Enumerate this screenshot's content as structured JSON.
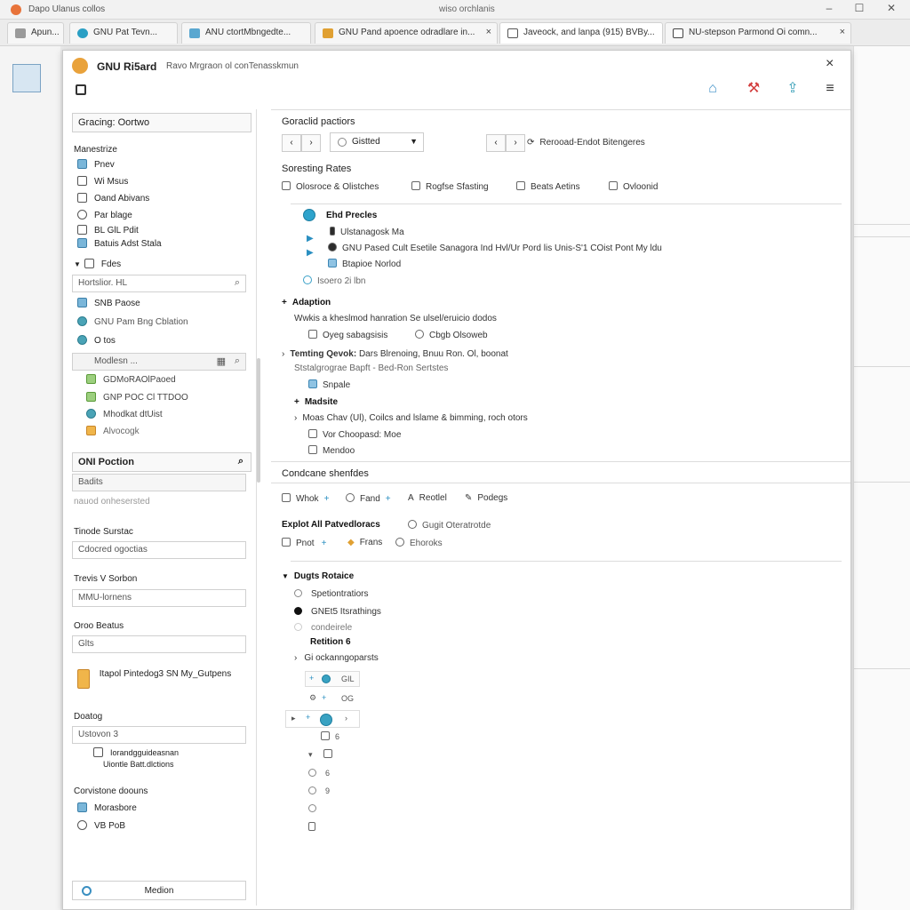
{
  "os": {
    "app": "Dapo Ulanus collos",
    "title": "wiso orchlanis",
    "minimize": "–",
    "maximize": "☐",
    "close": "✕"
  },
  "tabs": [
    {
      "label": "Apun...",
      "color": "#9a9a9a"
    },
    {
      "label": "GNU Pat Tevn...",
      "color": "#2a9fc4"
    },
    {
      "label": "ANU ctortMbngedte...",
      "color": "#5aa7d0"
    },
    {
      "label": "GNU Pand apoence odradlare in...",
      "color": "#e0a032",
      "close": "×"
    },
    {
      "label": "Javeock, and lanpa (915) BVBy...",
      "color": "#555555"
    },
    {
      "label": "NU-stepson Parmond Oi comn...",
      "color": "#444444",
      "close": "×"
    }
  ],
  "dialog": {
    "title": "GNU Ri5ard",
    "subtitle": "Ravo Mrgraon ol conTenasskmun",
    "close": "×",
    "header_icons": [
      "home-icon",
      "tools-icon",
      "share-icon",
      "menu-icon"
    ]
  },
  "sidebar": {
    "header": "Gracing: Oortwo",
    "section_manage": "Manestrize",
    "manage_items": [
      "Pnev",
      "Wi Msus",
      "Oand Abivans",
      "Par blage",
      "BL GlL Pdit",
      "Batuis Adst Stala"
    ],
    "files_label": "Fdes",
    "search_placeholder": "Hortslior. HL",
    "file_items": [
      "SNB Paose",
      "GNU Pam Bng Cblation",
      "O tos"
    ],
    "selected_item": "Modlesn ...",
    "sub_items": [
      "GDMoRAOlPaoed",
      "GNP POC Cl TTDOO",
      "Mhodkat dtUist",
      "Alvocogk"
    ],
    "section_action": "ONI Poction",
    "action_field": "Badits",
    "action_note": "nauod onhesersted",
    "label_1": "Tinode Surstac",
    "field_1": "Cdocred ogoctias",
    "label_2": "Trevis V Sorbon",
    "field_2": "MMU-lornens",
    "label_3": "Oroo Beatus",
    "field_3": "Glts",
    "promo_text": "Itapol Pintedog3 SN My_Gutpens",
    "label_4": "Doatog",
    "field_4": "Ustovon 3",
    "cb_line_1": "Iorandgguideasnan",
    "cb_line_2": "Uiontle Batt.dlctions",
    "label_5": "Corvistone doouns",
    "bottom_items": [
      "Morasbore",
      "VB PoB"
    ],
    "footer_button": "Medion"
  },
  "main": {
    "head_1": "Goraclid pactiors",
    "nav_back": "‹",
    "nav_forward": "›",
    "dropdown_value": "Gistted",
    "refresh_label": "Rerooad-Endot Bitengeres",
    "sort_head": "Soresting Rates",
    "sort_opts": [
      "Olosroce & Olistches",
      "Rogfse Sfasting",
      "Beats Aetins",
      "Ovloonid"
    ],
    "tree_title": "Ehd Precles",
    "tree_lines": [
      "Ulstanagosk Ma",
      "GNU Pased Cult Esetile Sanagora Ind Hvl/Ur Pord lis Unis-S'1 COist Pont My ldu",
      "Btapioe Norlod",
      "Isoero 2i lbn"
    ],
    "adaption_head": "Adaption",
    "adaption_desc": "Wwkis a kheslmod hanration Se ulsel/eruicio dodos",
    "adaption_opts": [
      "Oyeg sabagsisis",
      "Cbgb Olsoweb"
    ],
    "temp_head": "Temting Qevok:",
    "temp_desc": "Dars Blrenoing, Bnuu Ron. Ol, boonat",
    "temp_sub": "Ststalgrograe Bapft - Bed-Ron Sertstes",
    "temp_item": "Snpale",
    "madsite_head": "Madsite",
    "madsite_desc": "Moas Chav (Ul), Coilcs and lslame & bimming, roch otors",
    "madsite_items": [
      "Vor Choopasd: Moe",
      "Mendoo"
    ],
    "cond_head": "Condcane shenfdes",
    "cond_tools": [
      "Whok",
      "Fand",
      "Reotlel",
      "Podegs"
    ],
    "explot_head": "Explot All Patvedloracs",
    "explot_sub": "Gugit Oteratrotde",
    "explot_tools": [
      "Pnot",
      "Frans",
      "Ehoroks"
    ],
    "dugts_head": "Dugts Rotaice",
    "dugts_opts": [
      "Spetiontratiors",
      "GNEt5 Itsrathings",
      "condeirele"
    ],
    "retition": "Retition 6",
    "gi_label": "Gi ockanngoparsts",
    "tree_nodes": [
      "GIL",
      "OG",
      "",
      "6",
      "",
      "6",
      "9",
      "",
      ""
    ]
  }
}
